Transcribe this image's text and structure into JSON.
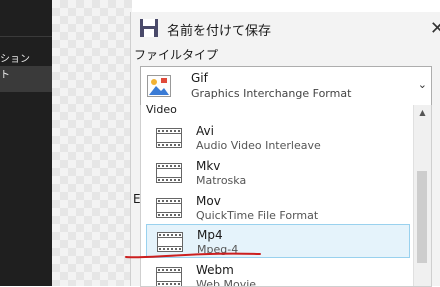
{
  "sidebar": {
    "items": [
      {
        "label": "ション"
      },
      {
        "label": "ト"
      }
    ]
  },
  "dialog": {
    "title": "名前を付けて保存",
    "close_glyph": "✕",
    "file_type_label": "ファイルタイプ",
    "selected": {
      "name": "Gif",
      "description": "Graphics Interchange Format",
      "icon": "image-file-icon"
    },
    "group_header": "Video",
    "partial_label": "E",
    "options": [
      {
        "name": "Avi",
        "description": "Audio Video Interleave",
        "icon": "film-icon",
        "selected": false
      },
      {
        "name": "Mkv",
        "description": "Matroska",
        "icon": "film-icon",
        "selected": false
      },
      {
        "name": "Mov",
        "description": "QuickTime File Format",
        "icon": "film-icon",
        "selected": false
      },
      {
        "name": "Mp4",
        "description": "Mpeg-4",
        "icon": "film-icon",
        "selected": true
      },
      {
        "name": "Webm",
        "description": "Web Movie",
        "icon": "film-icon",
        "selected": false
      }
    ]
  },
  "colors": {
    "accent": "#0078d4",
    "selection_bg": "#e5f3fb",
    "annotation": "#cc1f1f"
  }
}
